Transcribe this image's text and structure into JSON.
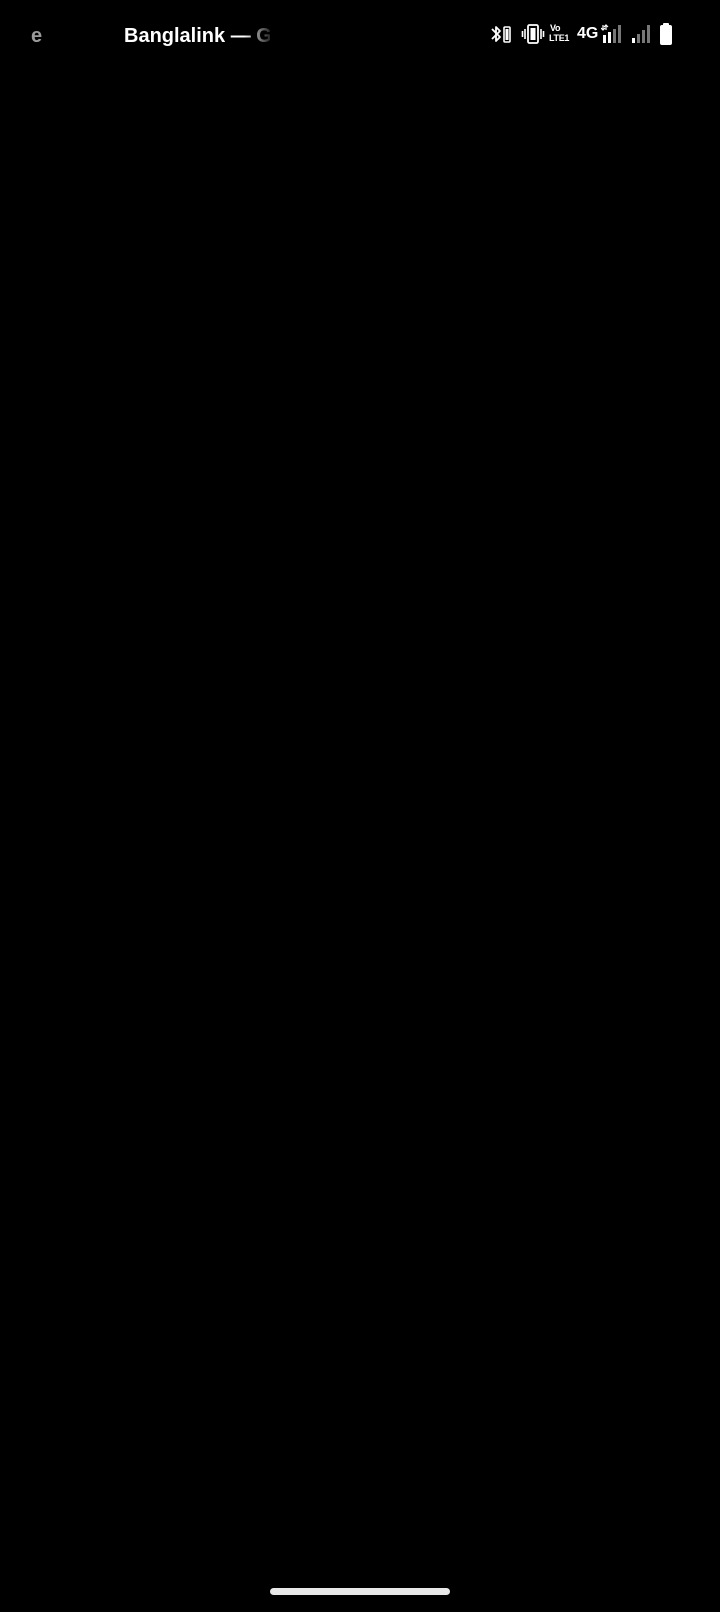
{
  "status_bar": {
    "ticker_fragment": "e",
    "carrier": "Banglalink — Gra",
    "volte_top": "Vo",
    "volte_bottom": "LTE1",
    "network_type": "4G",
    "icons": [
      "bluetooth-icon",
      "vibrate-icon",
      "volte-icon",
      "signal-sim1-icon",
      "signal-sim2-icon",
      "battery-icon"
    ]
  },
  "colors": {
    "background": "#000000",
    "foreground": "#ffffff",
    "dim_signal": "#777777"
  }
}
